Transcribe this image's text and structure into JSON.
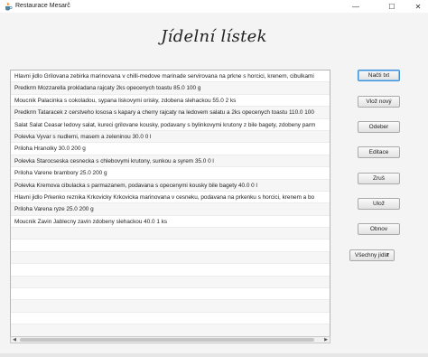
{
  "window": {
    "title": "Restaurace Mesarč",
    "icon": "java-cup-icon",
    "controls": {
      "minimize": "—",
      "maximize": "☐",
      "close": "✕"
    }
  },
  "heading": "Jídelní lístek",
  "menu_items": [
    "Hlavni jidlo Grilovana zebirka marinovana v chilli-medove marinade servirovana na prkne s horcici, krenem, cibulkami",
    "Predkrm Mozzarella prokladana rajcaty 2ks opecenych toastu 85.0 100 g",
    "Moucnik Palacinka s cokoladou, sypana liskovymi orisky, zdobena slehackou 55.0 2 ks",
    "Predkrm Tataracek z cerstveho lososa s kapary a cherry rajcaty na ledovem salatu a 2ks opecenych toastu 110.0 100",
    "Salat Salat Ceasar ledovy salat, kureci grilovane kousky, podavany s bylinkovymi krutony z bile bagety, zdobeny parm",
    "Polevka Vyvar s nudlemi, masem a zeleninou 30.0 0 l",
    "Priloha Hranolky  30.0 200 g",
    "Polevka Starocseska cesnecka s chlebovymi krutony, sunkou a syrem 35.0 0 l",
    "Priloha Varene brambory  25.0 200 g",
    "Polevka Kremova cibulacka s parmazanem, podavana s opecenymi kousky bile bagety 40.0 0 l",
    "Hlavni jidlo Prkenko reznika Krkovicky Krkovicka marinovana v cesneku, podavana na prkenku s horcici, krenem a bo",
    "Priloha Varena ryze  25.0 200 g",
    "Moucnik Zavin Jablecny zavin zdobeny slehackou 40.0 1 ks"
  ],
  "empty_rows": 9,
  "scrollbar": {
    "left_arrow": "◀",
    "right_arrow": "▶"
  },
  "buttons": {
    "load": "Načti txt",
    "insert": "Vlož nový",
    "remove": "Odeber",
    "edit": "Editace",
    "cancel": "Zruš",
    "save": "Ulož",
    "refresh": "Obnov"
  },
  "filter": {
    "selected": "Všechny jídla",
    "chevron": "▼"
  }
}
